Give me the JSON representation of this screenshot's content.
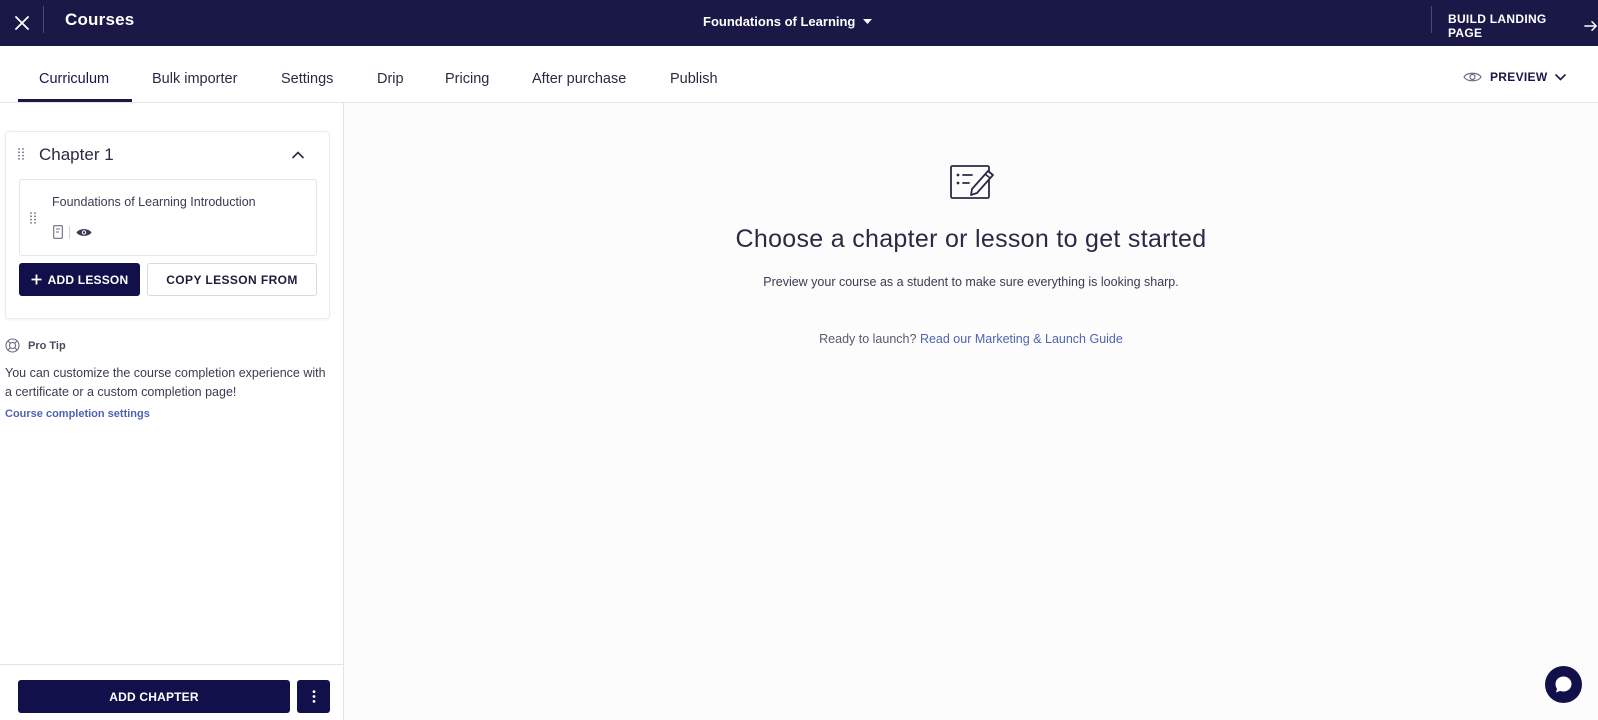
{
  "topbar": {
    "title": "Courses",
    "course_name": "Foundations of Learning",
    "build_landing_label": "BUILD LANDING PAGE"
  },
  "tabs": [
    {
      "label": "Curriculum",
      "active": true
    },
    {
      "label": "Bulk importer"
    },
    {
      "label": "Settings"
    },
    {
      "label": "Drip"
    },
    {
      "label": "Pricing"
    },
    {
      "label": "After purchase"
    },
    {
      "label": "Publish"
    }
  ],
  "preview_label": "PREVIEW",
  "sidebar": {
    "chapter": {
      "title": "Chapter 1",
      "lessons": [
        {
          "title": "Foundations of Learning Introduction"
        }
      ]
    },
    "add_lesson_label": "ADD LESSON",
    "copy_lesson_label": "COPY LESSON FROM",
    "pro_tip": {
      "heading": "Pro Tip",
      "body": "You can customize the course completion experience with a certificate or a custom completion page!",
      "link": "Course completion settings"
    },
    "add_chapter_label": "ADD CHAPTER"
  },
  "main": {
    "title": "Choose a chapter or lesson to get started",
    "subtitle": "Preview your course as a student to make sure everything is looking sharp.",
    "launch_prefix": "Ready to launch?",
    "launch_link": "Read our Marketing & Launch Guide"
  },
  "colors": {
    "topbar_bg": "#1a1847",
    "primary_button": "#12104a",
    "link": "#5163b0"
  }
}
